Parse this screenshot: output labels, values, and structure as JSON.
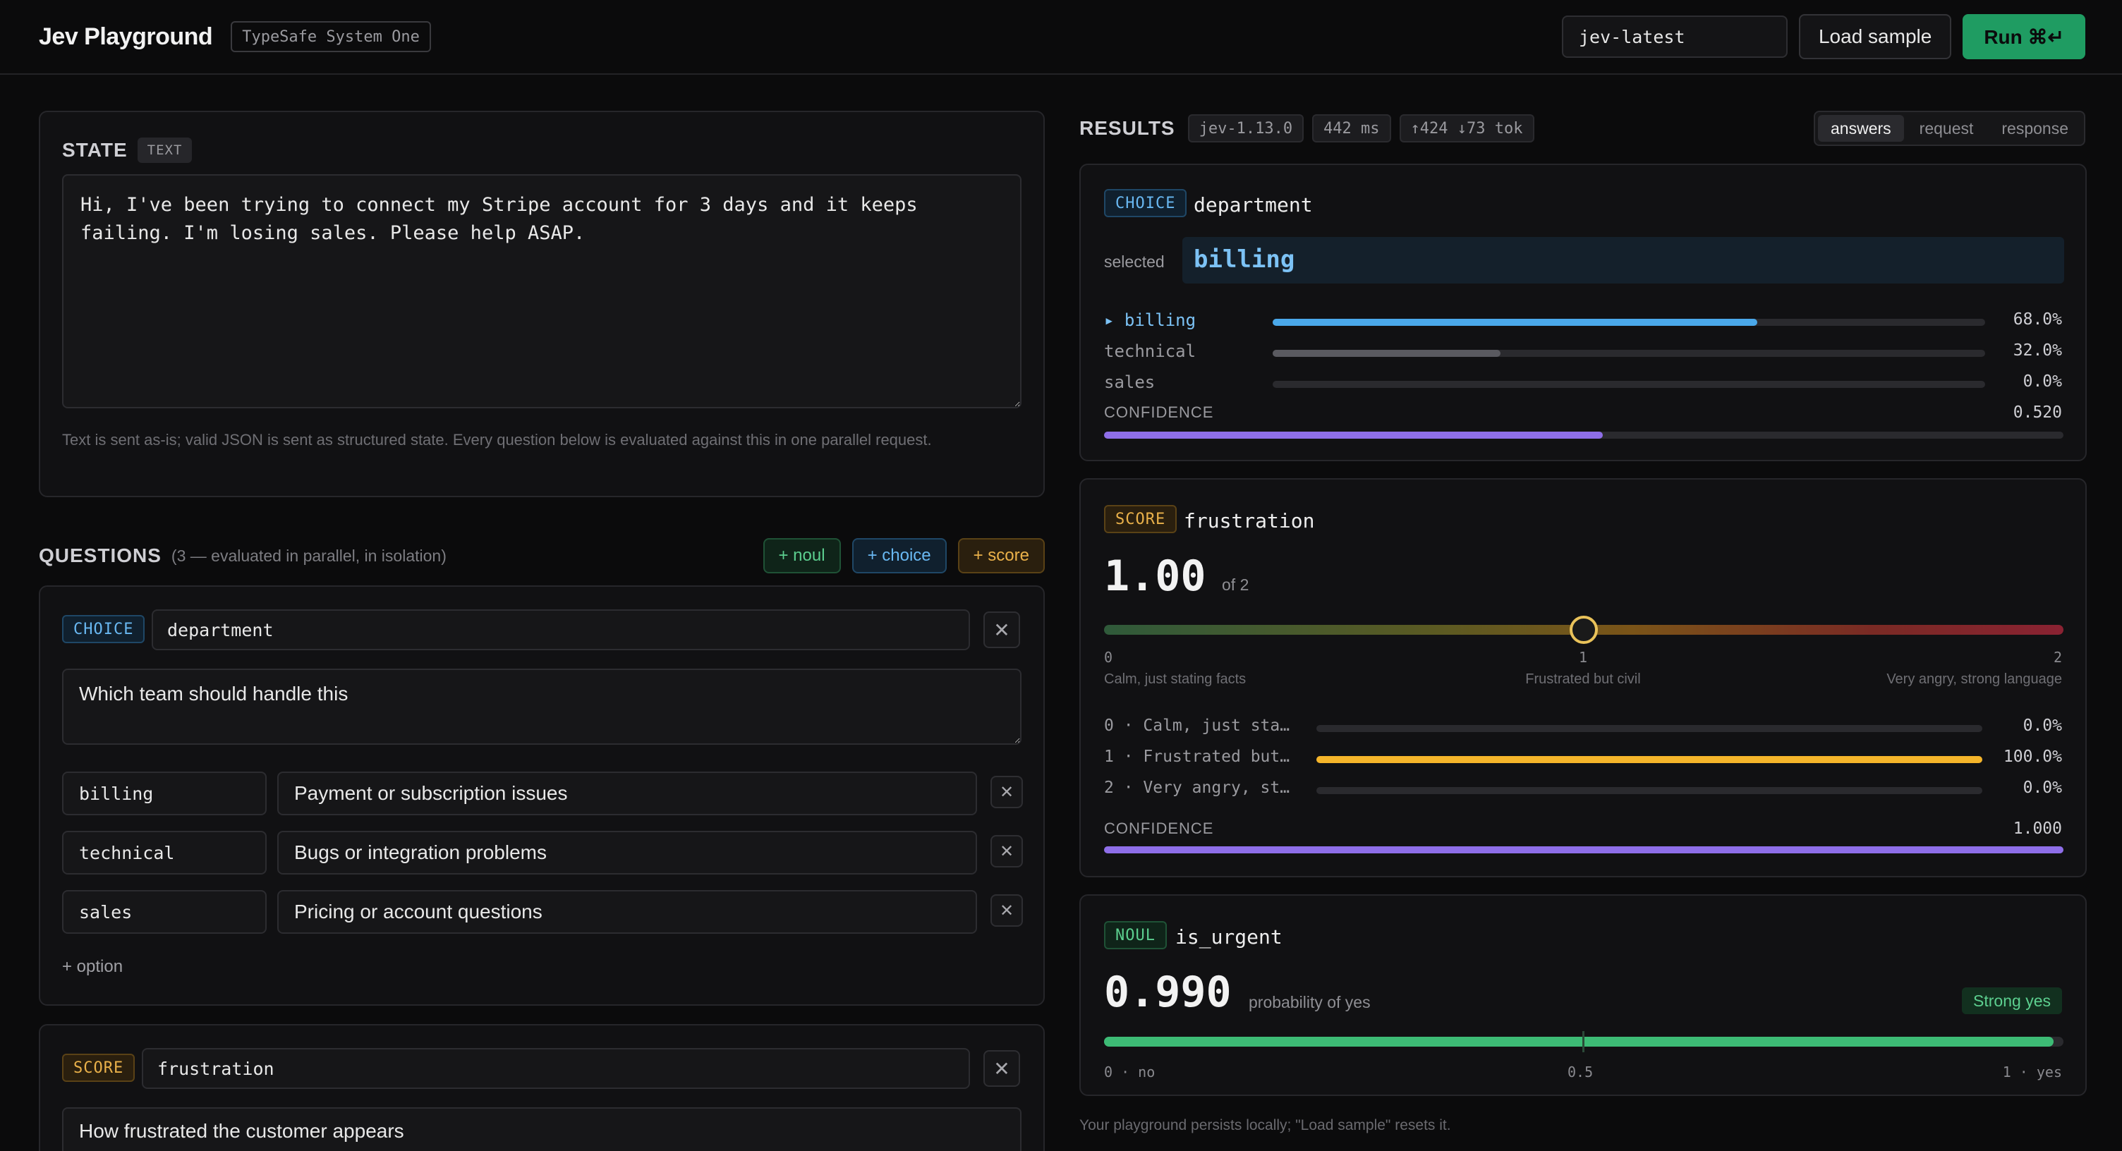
{
  "header": {
    "title": "Jev Playground",
    "badge": "TypeSafe System One",
    "model_value": "jev-latest",
    "load_label": "Load sample",
    "run_label": "Run ⌘↵"
  },
  "state": {
    "title": "STATE",
    "tag": "TEXT",
    "text": "Hi, I've been trying to connect my Stripe account for 3 days and it keeps failing. I'm losing sales. Please help ASAP.",
    "help": "Text is sent as-is; valid JSON is sent as structured state. Every question below is evaluated against this in one parallel request."
  },
  "questions": {
    "title": "QUESTIONS",
    "subtitle": "(3 — evaluated in parallel, in isolation)",
    "add_noul": "+ noul",
    "add_choice": "+ choice",
    "add_score": "+ score",
    "choice_card": {
      "tag": "CHOICE",
      "name": "department",
      "prompt": "Which team should handle this",
      "options": [
        {
          "key": "billing",
          "desc": "Payment or subscription issues"
        },
        {
          "key": "technical",
          "desc": "Bugs or integration problems"
        },
        {
          "key": "sales",
          "desc": "Pricing or account questions"
        }
      ],
      "add_option": "+ option"
    },
    "score_card": {
      "tag": "SCORE",
      "name": "frustration",
      "prompt": "How frustrated the customer appears"
    }
  },
  "results": {
    "title": "RESULTS",
    "version": "jev-1.13.0",
    "latency": "442 ms",
    "tokens": "↑424 ↓73 tok",
    "tabs": [
      "answers",
      "request",
      "response"
    ],
    "active_tab": "answers",
    "choice": {
      "tag": "CHOICE",
      "name": "department",
      "selected_label": "selected",
      "selected_value": "billing",
      "rows": [
        {
          "label": "▸ billing",
          "pct": "68.0%",
          "value": 0.68,
          "color": "#4aa8ea",
          "highlight": true
        },
        {
          "label": "technical",
          "pct": "32.0%",
          "value": 0.32,
          "color": "#5a5a60",
          "highlight": false
        },
        {
          "label": "sales",
          "pct": "0.0%",
          "value": 0.0,
          "color": "#5a5a60",
          "highlight": false
        }
      ],
      "confidence_label": "CONFIDENCE",
      "confidence_value": "0.520",
      "confidence": 0.52
    },
    "score": {
      "tag": "SCORE",
      "name": "frustration",
      "value": "1.00",
      "of": "of 2",
      "position": 0.5,
      "ticks": [
        "0",
        "1",
        "2"
      ],
      "tick_labels": [
        "Calm, just stating facts",
        "Frustrated but civil",
        "Very angry, strong language"
      ],
      "rows": [
        {
          "label": "0 · Calm, just sta…",
          "pct": "0.0%",
          "value": 0.0
        },
        {
          "label": "1 · Frustrated but…",
          "pct": "100.0%",
          "value": 1.0
        },
        {
          "label": "2 · Very angry, st…",
          "pct": "0.0%",
          "value": 0.0
        }
      ],
      "confidence_label": "CONFIDENCE",
      "confidence_value": "1.000",
      "confidence": 1.0
    },
    "noul": {
      "tag": "NOUL",
      "name": "is_urgent",
      "value": "0.990",
      "caption": "probability of yes",
      "verdict": "Strong yes",
      "probability": 0.99,
      "axis": [
        "0 · no",
        "0.5",
        "1 · yes"
      ]
    },
    "footer": "Your playground persists locally; \"Load sample\" resets it."
  },
  "colors": {
    "accent_green": "#1f9c62",
    "choice_blue": "#4aa8ea",
    "score_amber": "#f5b52a",
    "confidence_purple": "#8e6ee8"
  }
}
